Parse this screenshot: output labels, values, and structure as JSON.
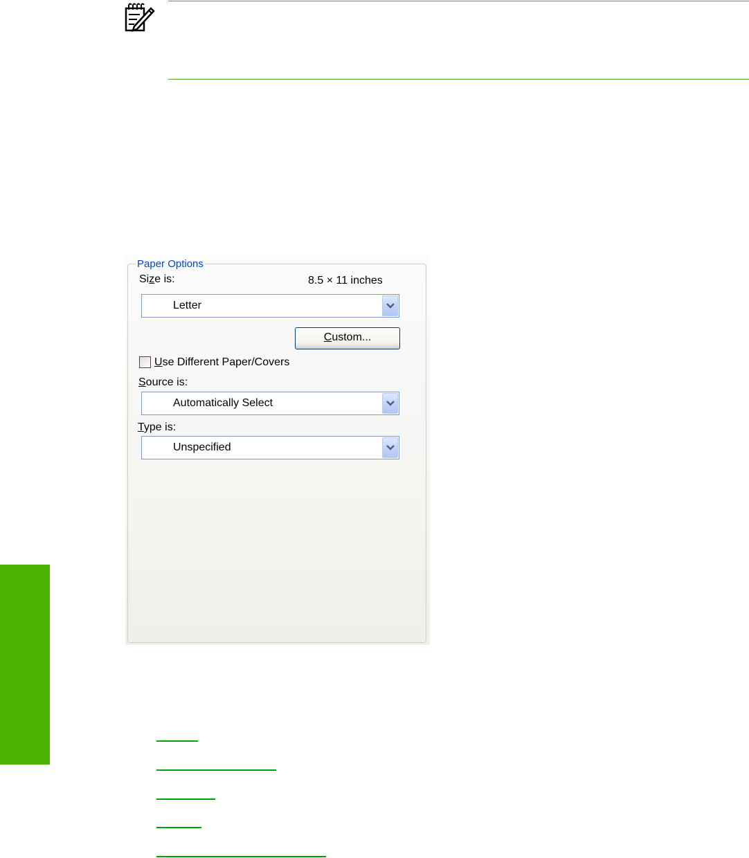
{
  "note": {
    "icon": "note-icon"
  },
  "paper_options": {
    "group_title": "Paper Options",
    "size_label_prefix": "Si",
    "size_label_underlined": "z",
    "size_label_suffix": "e is:",
    "size_dimensions": "8.5 × 11 inches",
    "size_value": "Letter",
    "custom_button_underlined": "C",
    "custom_button_suffix": "ustom...",
    "checkbox_underlined": "U",
    "checkbox_suffix": "se Different Paper/Covers",
    "checkbox_checked": false,
    "source_label_underlined": "S",
    "source_label_suffix": "ource is:",
    "source_value": "Automatically Select",
    "type_label_underlined": "T",
    "type_label_suffix": "ype is:",
    "type_value": "Unspecified"
  },
  "colors": {
    "side_tab": "#4db101",
    "note_rule": "#55aa1a",
    "group_title": "#0046d5",
    "link": "#00a000"
  }
}
